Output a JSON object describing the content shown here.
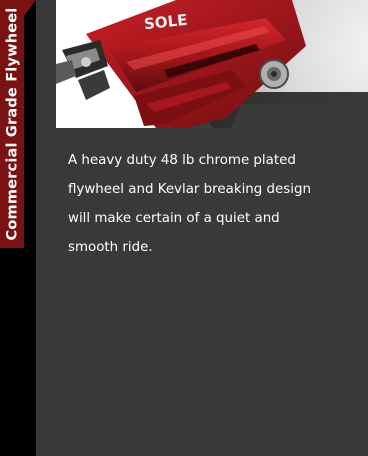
{
  "side_tab": {
    "label": "Commercial Grade Flywheel",
    "color": "#7a1214"
  },
  "photo": {
    "brand_text": "SOLE"
  },
  "description": {
    "lines": [
      "A heavy duty 48 lb chrome plated",
      "flywheel and Kevlar breaking design",
      "will make certain of a quiet and",
      "smooth ride."
    ]
  },
  "colors": {
    "background": "#000000",
    "panel": "#393939",
    "accent": "#7a1214",
    "text": "#ffffff"
  }
}
